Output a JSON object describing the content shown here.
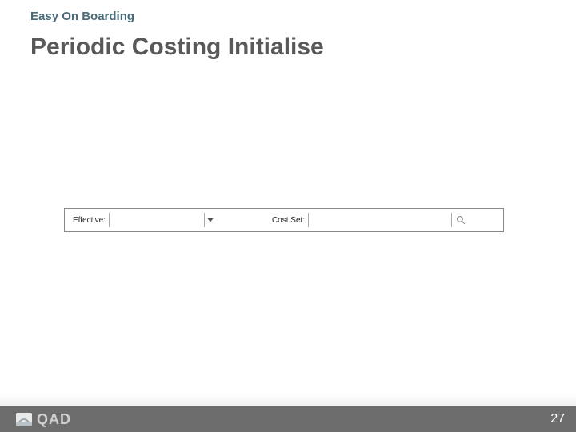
{
  "header": {
    "subtitle": "Easy On Boarding",
    "title": "Periodic Costing Initialise"
  },
  "form": {
    "effective": {
      "label": "Effective:",
      "value": ""
    },
    "cost_set": {
      "label": "Cost Set:",
      "value": ""
    }
  },
  "footer": {
    "logo_text": "QAD",
    "page_number": "27"
  }
}
